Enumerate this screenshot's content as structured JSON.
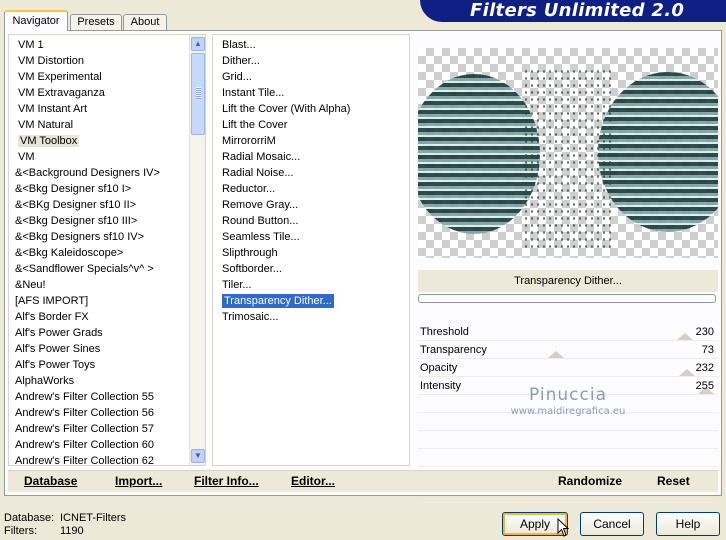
{
  "tabs": [
    "Navigator",
    "Presets",
    "About"
  ],
  "banner_title": "Filters Unlimited 2.0",
  "categories": [
    "VM 1",
    "VM Distortion",
    "VM Experimental",
    "VM Extravaganza",
    "VM Instant Art",
    "VM Natural",
    "VM Toolbox",
    "VM",
    "&<Background Designers IV>",
    "&<Bkg Designer sf10 I>",
    "&<BKg Designer sf10 II>",
    "&<Bkg Designer sf10 III>",
    "&<Bkg Designers sf10 IV>",
    "&<Bkg Kaleidoscope>",
    "&<Sandflower Specials^v^ >",
    "&Neu!",
    "[AFS IMPORT]",
    "Alf's Border FX",
    "Alf's Power Grads",
    "Alf's Power Sines",
    "Alf's Power Toys",
    "AlphaWorks",
    "Andrew's Filter Collection 55",
    "Andrew's Filter Collection 56",
    "Andrew's Filter Collection 57",
    "Andrew's Filter Collection 60",
    "Andrew's Filter Collection 62"
  ],
  "selected_category": "VM Toolbox",
  "filters": [
    "Blast...",
    "Dither...",
    "Grid...",
    "Instant Tile...",
    "Lift the Cover (With Alpha)",
    "Lift the Cover",
    "MirrororriM",
    "Radial Mosaic...",
    "Radial Noise...",
    "Reductor...",
    "Remove Gray...",
    "Round Button...",
    "Seamless Tile...",
    "Slipthrough",
    "Softborder...",
    "Tiler...",
    "Transparency Dither...",
    "Trimosaic..."
  ],
  "selected_filter": "Transparency Dither...",
  "current_filter_name": "Transparency Dither...",
  "params": [
    {
      "label": "Threshold",
      "value": "230",
      "level": 0.902
    },
    {
      "label": "Transparency",
      "value": "73",
      "level": 0.286
    },
    {
      "label": "Opacity",
      "value": "232",
      "level": 0.91
    },
    {
      "label": "Intensity",
      "value": "255",
      "level": 1.0
    }
  ],
  "watermark": {
    "name": "Pinuccia",
    "url": "www.maidiregrafica.eu"
  },
  "actions": {
    "database": "Database",
    "import": "Import...",
    "filter_info": "Filter Info...",
    "editor": "Editor...",
    "randomize": "Randomize",
    "reset": "Reset"
  },
  "status": {
    "database_label": "Database:",
    "database_value": "ICNET-Filters",
    "filters_label": "Filters:",
    "filters_value": "1190"
  },
  "buttons": {
    "apply": "Apply",
    "cancel": "Cancel",
    "help": "Help"
  }
}
